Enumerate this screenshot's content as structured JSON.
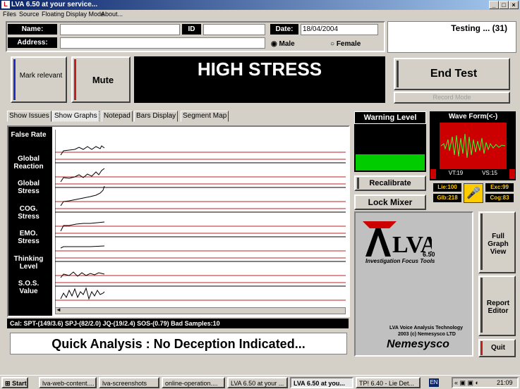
{
  "window": {
    "title": "LVA 6.50 at your service...",
    "min": "_",
    "max": "□",
    "close": "×"
  },
  "menu": [
    "Files",
    "Source",
    "Floating Display Mode",
    "About..."
  ],
  "form": {
    "name_label": "Name:",
    "name_value": "",
    "id_label": "ID",
    "id_value": "",
    "date_label": "Date:",
    "date_value": "18/04/2004",
    "address_label": "Address:",
    "address_value": "",
    "male": "Male",
    "female": "Female",
    "gender_selected": "Male"
  },
  "status": {
    "testing": "Testing ... (31)"
  },
  "buttons": {
    "mark_relevant": "Mark relevant",
    "mute": "Mute",
    "end_test": "End Test",
    "record_mode": "Record Mode",
    "recalibrate": "Recalibrate",
    "lock_mixer": "Lock Mixer",
    "full_graph_view": "Full Graph View",
    "report_editor": "Report Editor",
    "quit": "Quit"
  },
  "stress_banner": "HIGH STRESS",
  "tabs": [
    "Show Issues",
    "Show Graphs",
    "Notepad",
    "Bars Display",
    "Segment Map"
  ],
  "active_tab": "Show Graphs",
  "graph_rows": [
    "False Rate",
    "Global Reaction",
    "Global Stress",
    "COG. Stress",
    "EMO. Stress",
    "Thinking Level",
    "S.O.S. Value"
  ],
  "cal_text": "Cal: SPT-(149/3.6) SPJ-(82/2.0) JQ-(19/2.4) SOS-(0.79) Bad Samples:10",
  "quick_analysis": "Quick Analysis : No Deception Indicated...",
  "warning": {
    "title": "Warning Level",
    "level": 0.35,
    "color": "#00cc00"
  },
  "waveform": {
    "title": "Wave Form(<-)",
    "v1": "VT:19",
    "vs": "VS:15"
  },
  "meters": {
    "lie": "Lie:100",
    "glb": "Glb:218",
    "exc": "Exc:99",
    "cog": "Cog:83"
  },
  "logo": {
    "brand": "LVA",
    "version": "6.50",
    "tagline": "Investigation Focus Tools",
    "tech": "LVA Voice Analysis Technology",
    "copyright": "2003 (c) Nemesysco LTD",
    "company": "Nemesysco"
  },
  "taskbar": {
    "start": "Start",
    "items": [
      "lva-web-content....",
      "lva-screenshots",
      "online-operation....",
      "LVA 6.50 at your ...",
      "LVA 6.50 at you...",
      "TP! 6.40 - Lie Det..."
    ],
    "lang": "EN",
    "clock": "21:09"
  }
}
